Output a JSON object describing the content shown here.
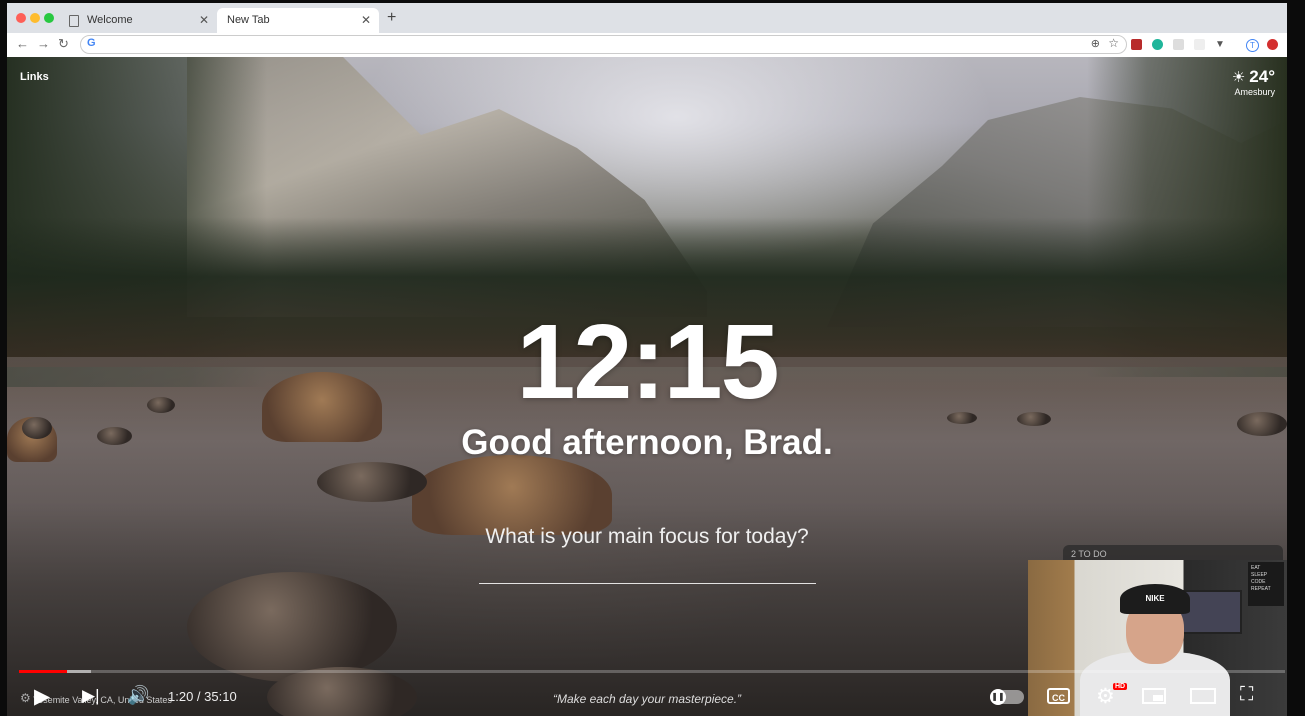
{
  "browser": {
    "tabs": [
      {
        "title": "Welcome",
        "active": false
      },
      {
        "title": "New Tab",
        "active": true
      }
    ],
    "new_tab_symbol": "+",
    "omnibox_value": "",
    "omnibox_icon": "G"
  },
  "momentum": {
    "links_label": "Links",
    "weather": {
      "temp": "24°",
      "city": "Amesbury",
      "icon": "sun-icon"
    },
    "clock": "12:15",
    "greeting": "Good afternoon, Brad.",
    "focus_prompt": "What is your main focus for today?",
    "focus_value": "",
    "quote": "“Make each day your masterpiece.”",
    "photo_location": "Yosemite Valley, CA, United States"
  },
  "todo_peek": "2 TO DO",
  "webcam": {
    "cap_text": "NIKE",
    "poster_lines": [
      "EAT",
      "SLEEP",
      "CODE",
      "REPEAT"
    ]
  },
  "player": {
    "time": "1:20 / 35:10",
    "progress_played": 0.038,
    "progress_buffered": 0.057,
    "cc_label": "CC",
    "hd_badge": "HD"
  },
  "colors": {
    "progress": "#ff0000",
    "hd_badge": "#ff0000"
  }
}
